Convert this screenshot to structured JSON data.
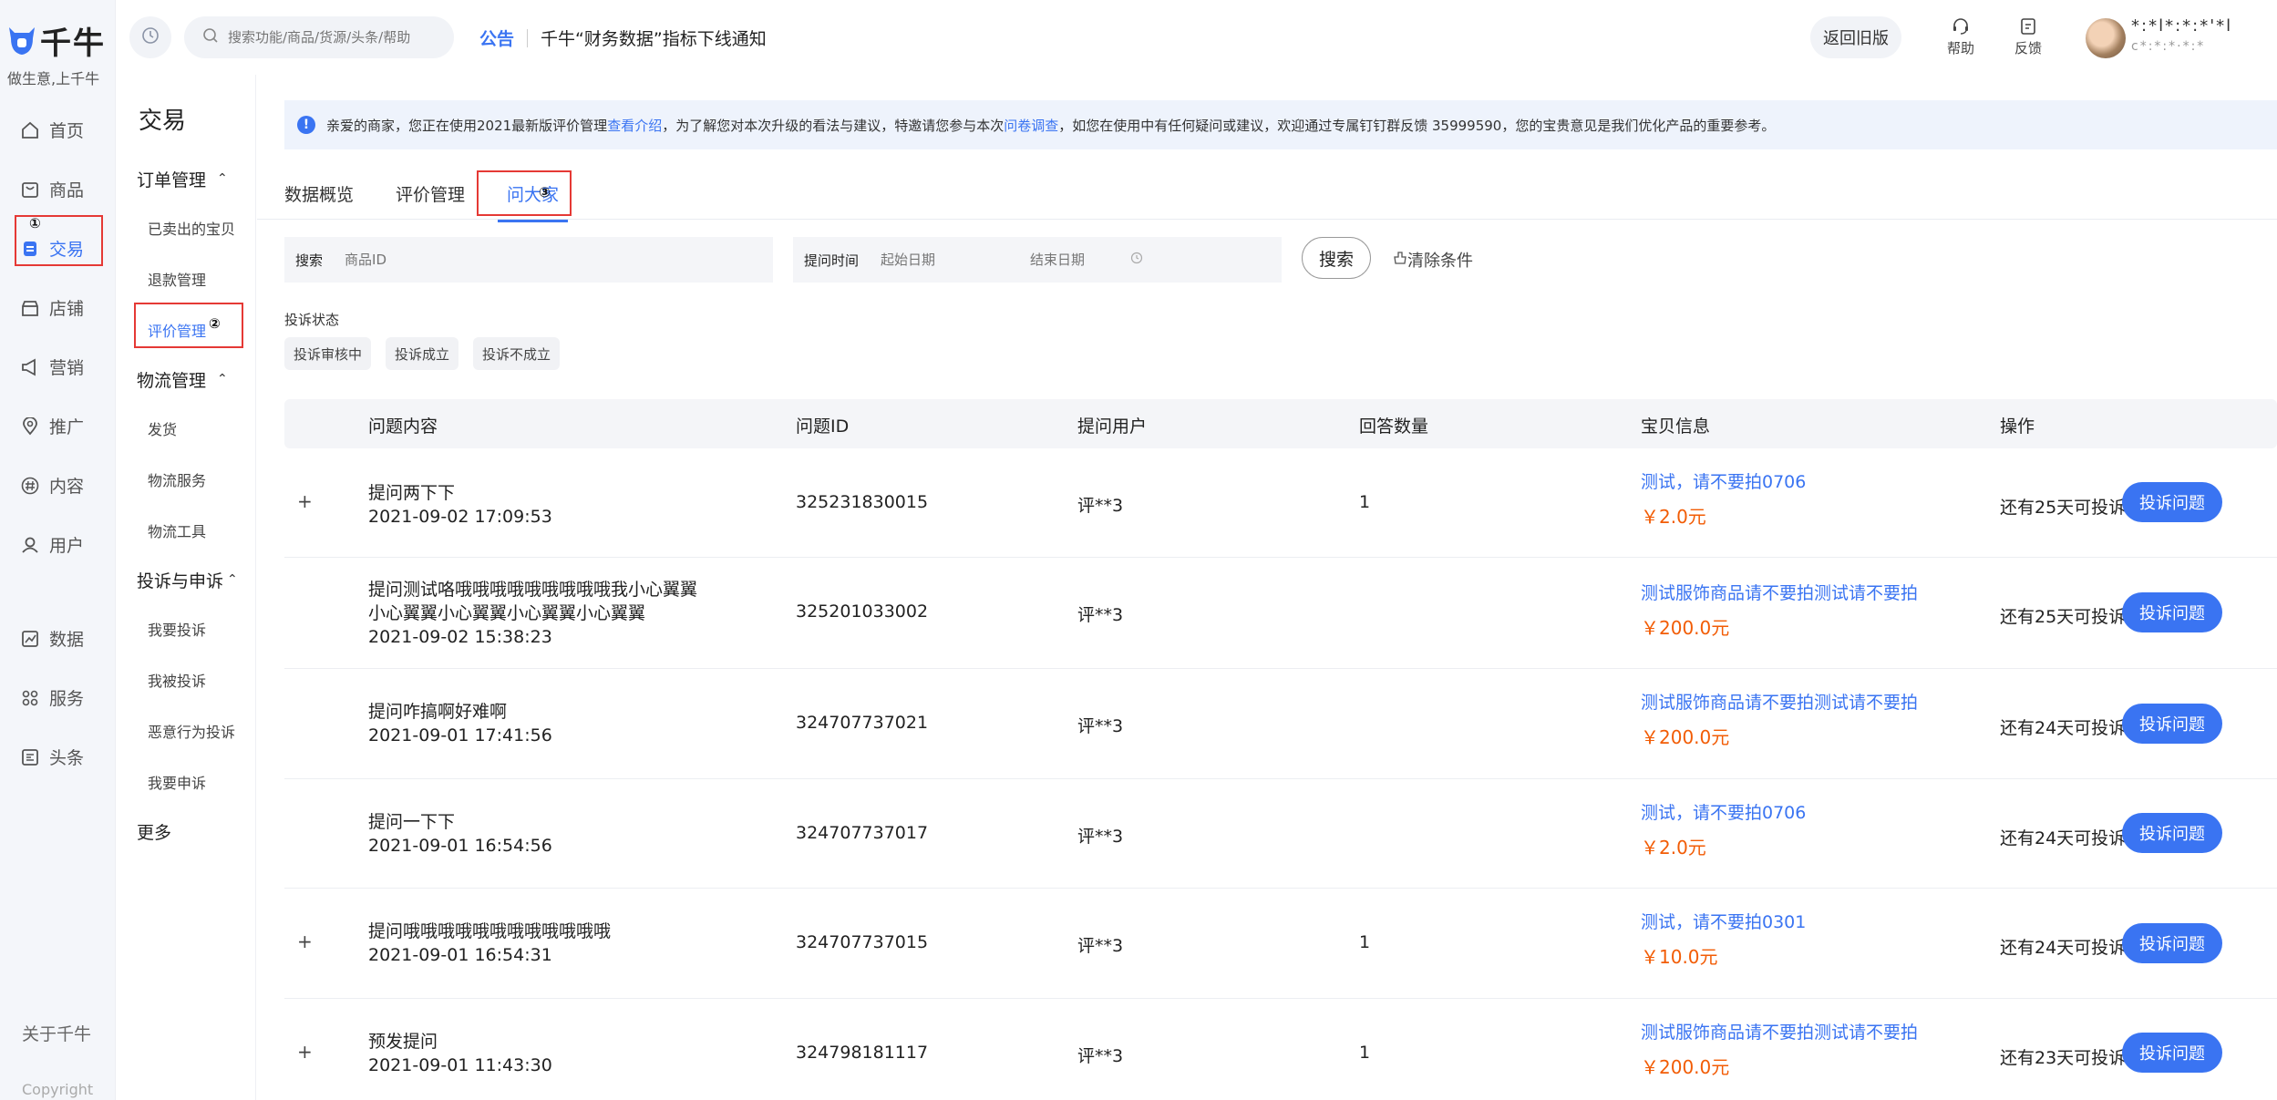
{
  "brand": {
    "name": "千牛",
    "slogan": "做生意,上千牛"
  },
  "nav_primary": [
    {
      "label": "首页",
      "icon": "home-icon"
    },
    {
      "label": "商品",
      "icon": "goods-icon"
    },
    {
      "label": "交易",
      "icon": "trade-icon",
      "active": true
    },
    {
      "label": "店铺",
      "icon": "shop-icon"
    },
    {
      "label": "营销",
      "icon": "megaphone-icon"
    },
    {
      "label": "推广",
      "icon": "location-icon"
    },
    {
      "label": "内容",
      "icon": "hashtag-icon"
    },
    {
      "label": "用户",
      "icon": "user-icon"
    },
    {
      "label": "数据",
      "icon": "chart-icon"
    },
    {
      "label": "服务",
      "icon": "grid-icon"
    },
    {
      "label": "头条",
      "icon": "news-icon"
    }
  ],
  "nav_footer": {
    "about": "关于千牛",
    "copyright": "Copyright"
  },
  "annotations": {
    "step1": "①",
    "step2": "②",
    "step3": "③"
  },
  "nav_secondary": {
    "title": "交易",
    "groups": [
      {
        "label": "订单管理",
        "items": [
          "已卖出的宝贝",
          "退款管理",
          "评价管理"
        ]
      },
      {
        "label": "物流管理",
        "items": [
          "发货",
          "物流服务",
          "物流工具"
        ]
      },
      {
        "label": "投诉与申诉",
        "items": [
          "我要投诉",
          "我被投诉",
          "恶意行为投诉",
          "我要申诉"
        ]
      }
    ],
    "more": "更多"
  },
  "topbar": {
    "search_placeholder": "搜索功能/商品/货源/头条/帮助",
    "notice_tag": "公告",
    "notice_text": "千牛“财务数据”指标下线通知",
    "old_version": "返回旧版",
    "help": "帮助",
    "feedback": "反馈",
    "user_line1": "*:*l*:*:*'*l",
    "user_line2": "c*:*:*·*:*"
  },
  "info_bar": {
    "part1": "亲爱的商家，您正在使用2021最新版评价管理 ",
    "link1": "查看介绍",
    "part2": "，为了解您对本次升级的看法与建议，特邀请您参与本次 ",
    "link2": "问卷调查",
    "part3": "，如您在使用中有任何疑问或建议，欢迎通过专属钉钉群反馈 35999590，您的宝贵意见是我们优化产品的重要参考。"
  },
  "tabs": [
    "数据概览",
    "评价管理",
    "问大家"
  ],
  "filters": {
    "search_label": "搜索",
    "search_placeholder": "商品ID",
    "time_label": "提问时间",
    "start_placeholder": "起始日期",
    "end_placeholder": "结束日期",
    "search_button": "搜索",
    "clear_button": "清除条件",
    "status_label": "投诉状态",
    "status_chips": [
      "投诉审核中",
      "投诉成立",
      "投诉不成立"
    ]
  },
  "table": {
    "columns": [
      "问题内容",
      "问题ID",
      "提问用户",
      "回答数量",
      "宝贝信息",
      "操作"
    ],
    "rows": [
      {
        "expand": "+",
        "question": [
          "提问两下下"
        ],
        "time": "2021-09-02 17:09:53",
        "qid": "325231830015",
        "user": "评**3",
        "answers": "1",
        "goods": "测试，请不要拍0706",
        "price": "￥2.0元",
        "remain": "还有25天可投诉",
        "action": "投诉问题"
      },
      {
        "expand": "",
        "question": [
          "提问测试咯哦哦哦哦哦哦哦哦哦我小心翼翼",
          "小心翼翼小心翼翼小心翼翼小心翼翼"
        ],
        "time": "2021-09-02 15:38:23",
        "qid": "325201033002",
        "user": "评**3",
        "answers": "",
        "goods": "测试服饰商品请不要拍测试请不要拍",
        "price": "￥200.0元",
        "remain": "还有25天可投诉",
        "action": "投诉问题"
      },
      {
        "expand": "",
        "question": [
          "提问咋搞啊好难啊"
        ],
        "time": "2021-09-01 17:41:56",
        "qid": "324707737021",
        "user": "评**3",
        "answers": "",
        "goods": "测试服饰商品请不要拍测试请不要拍",
        "price": "￥200.0元",
        "remain": "还有24天可投诉",
        "action": "投诉问题"
      },
      {
        "expand": "",
        "question": [
          "提问一下下"
        ],
        "time": "2021-09-01 16:54:56",
        "qid": "324707737017",
        "user": "评**3",
        "answers": "",
        "goods": "测试，请不要拍0706",
        "price": "￥2.0元",
        "remain": "还有24天可投诉",
        "action": "投诉问题"
      },
      {
        "expand": "+",
        "question": [
          "提问哦哦哦哦哦哦哦哦哦哦哦哦"
        ],
        "time": "2021-09-01 16:54:31",
        "qid": "324707737015",
        "user": "评**3",
        "answers": "1",
        "goods": "测试，请不要拍0301",
        "price": "￥10.0元",
        "remain": "还有24天可投诉",
        "action": "投诉问题"
      },
      {
        "expand": "+",
        "question": [
          "预发提问"
        ],
        "time": "2021-09-01 11:43:30",
        "qid": "324798181117",
        "user": "评**3",
        "answers": "1",
        "goods": "测试服饰商品请不要拍测试请不要拍",
        "price": "￥200.0元",
        "remain": "还有23天可投诉",
        "action": "投诉问题"
      }
    ]
  },
  "colors": {
    "accent": "#3a74f2",
    "price": "#f25c05",
    "annotation_box": "#e53935"
  }
}
